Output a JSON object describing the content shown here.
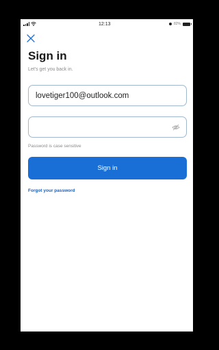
{
  "status_bar": {
    "time": "12:13",
    "battery_text": "82%",
    "icons": [
      "signal-icon",
      "wifi-icon",
      "lock-icon",
      "battery-icon"
    ]
  },
  "header": {
    "close_icon": "close-icon",
    "title": "Sign in",
    "subtitle": "Let's get you back in."
  },
  "form": {
    "email_value": "lovetiger100@outlook.com",
    "password_value": "",
    "password_hint": "Password is case sensitive",
    "eye_icon": "eye-hidden-icon",
    "signin_label": "Sign in",
    "forgot_label": "Forgot your password"
  },
  "colors": {
    "accent": "#1a6fd6",
    "link": "#1a5fb8",
    "input_border": "#9fb7cf",
    "background": "#ffffff",
    "frame": "#000000"
  }
}
